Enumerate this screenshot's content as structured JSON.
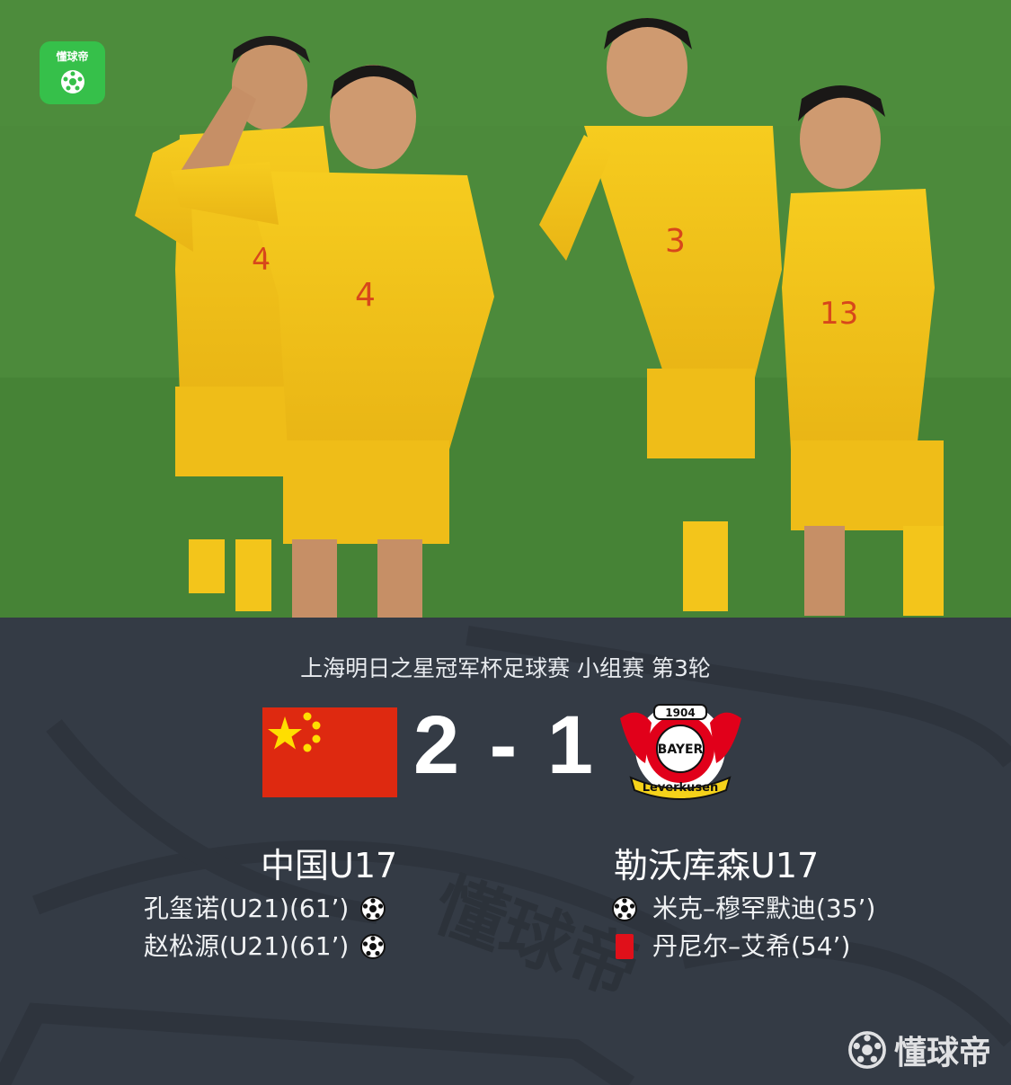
{
  "app": {
    "logo_text": "懂球帝",
    "watermark_text": "懂球帝",
    "panel_watermark": "懂球帝"
  },
  "photo": {
    "jersey_numbers": [
      "4",
      "4",
      "3",
      "13"
    ]
  },
  "match": {
    "competition": "上海明日之星冠军杯足球赛 小组赛 第3轮",
    "score": "2 - 1",
    "home": {
      "name": "中国U17",
      "flag": "china-flag-icon",
      "events": [
        {
          "text": "孔玺诺(U21)(61’)",
          "icon": "soccer-ball-icon"
        },
        {
          "text": "赵松源(U21)(61’)",
          "icon": "soccer-ball-icon"
        }
      ]
    },
    "away": {
      "name": "勒沃库森U17",
      "crest_text": {
        "year": "1904",
        "word": "BAYER",
        "club": "Leverkusen"
      },
      "events": [
        {
          "text": "米克–穆罕默迪(35’)",
          "icon": "soccer-ball-icon"
        },
        {
          "text": "丹尼尔–艾希(54’)",
          "icon": "red-card-icon"
        }
      ]
    }
  },
  "colors": {
    "panel_bg": "#343b45",
    "app_green": "#36c04a",
    "china_red": "#de2910",
    "china_gold": "#ffde00",
    "card_red": "#e0101a",
    "jersey_yellow": "#f5c518"
  }
}
